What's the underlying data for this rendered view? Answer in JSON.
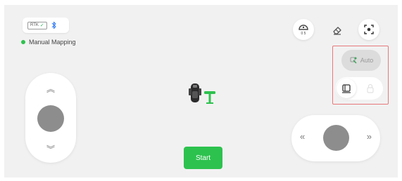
{
  "status": {
    "rtk_label": "RTK",
    "rtk_ok": true,
    "bluetooth": "bluetooth-icon",
    "mode_text": "Manual Mapping",
    "mode_color": "#2dc24e"
  },
  "toolbar": {
    "dome_icon": "dome-icon",
    "dome_caption": "0 5",
    "eraser_icon": "eraser-icon",
    "target_icon": "target-icon"
  },
  "control_group": {
    "auto_label": "Auto",
    "auto_icon": "auto-mode-icon",
    "manual_icon": "manual-mode-icon",
    "lock_icon": "lock-icon",
    "highlight_color": "#e7787a"
  },
  "left_joystick": {
    "up_glyph": "︽",
    "down_glyph": "︾"
  },
  "right_joystick": {
    "left_glyph": "«",
    "right_glyph": "»"
  },
  "start_button": {
    "label": "Start",
    "color": "#2dc24e"
  }
}
